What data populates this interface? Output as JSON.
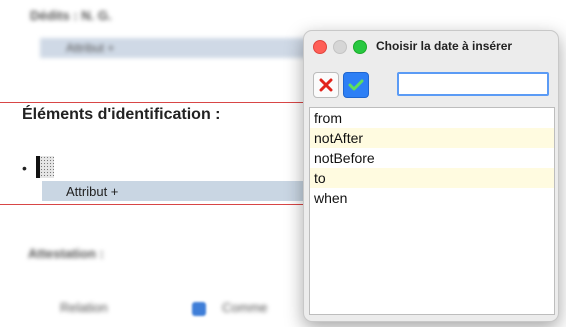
{
  "document": {
    "blurred_heading": "Dédits : N. G.",
    "blurred_attribute": "Attribut +",
    "section_title": "Éléments d'identification :",
    "bullet": "•",
    "attribute_label": "Attribut +",
    "blurred_attestation": "Attestation :",
    "blurred_relation": "Relation",
    "blurred_comment": "Comme"
  },
  "dialog": {
    "title": "Choisir la date à insérer",
    "cancel_label": "✕",
    "ok_label": "✓",
    "input_value": "",
    "items": [
      {
        "label": "from",
        "highlighted": false
      },
      {
        "label": "notAfter",
        "highlighted": true
      },
      {
        "label": "notBefore",
        "highlighted": false
      },
      {
        "label": "to",
        "highlighted": true
      },
      {
        "label": "when",
        "highlighted": false
      }
    ]
  },
  "colors": {
    "accent": "#2d7ff5",
    "close_red": "#ff5f57",
    "max_green": "#28c840",
    "highlight": "#fffbe0",
    "attr_band": "#c9d6e3",
    "rule_red": "#d84646"
  }
}
